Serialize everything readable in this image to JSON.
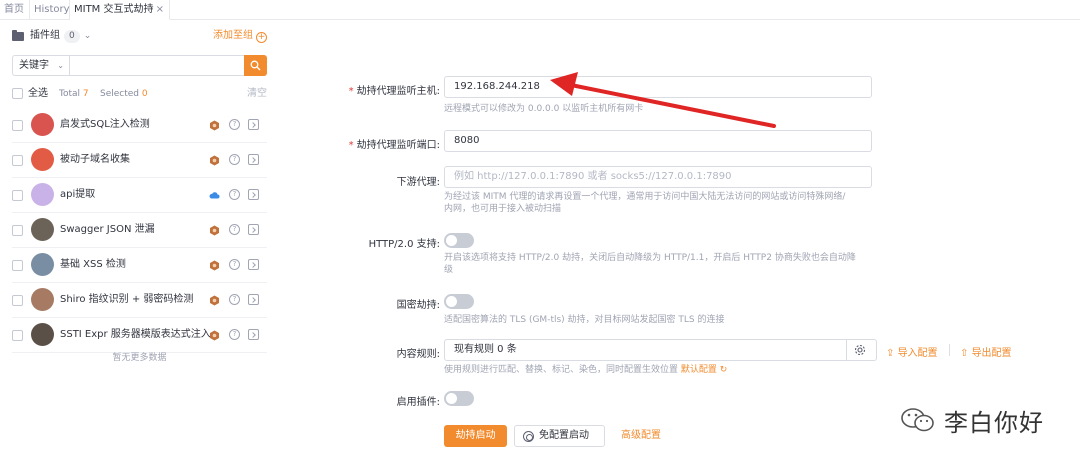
{
  "tabs": [
    {
      "label": "首页"
    },
    {
      "label": "History"
    },
    {
      "label": "MITM 交互式劫持",
      "close": "×"
    }
  ],
  "sidebar": {
    "group_label": "插件组",
    "group_count": "0",
    "add_group": "添加至组",
    "search": {
      "select_value": "关键字",
      "value": ""
    },
    "select_all": "全选",
    "total_label": "Total",
    "total_value": "7",
    "selected_label": "Selected",
    "selected_value": "0",
    "clear": "清空",
    "plugins": [
      {
        "name": "启发式SQL注入检测",
        "type_icon": "hexagon-badge-icon",
        "avatar_color": "#d9534f"
      },
      {
        "name": "被动子域名收集",
        "type_icon": "hexagon-badge-icon",
        "avatar_color": "#e25b45"
      },
      {
        "name": "api提取",
        "type_icon": "cloud-icon",
        "avatar_color": "#c9b2e8"
      },
      {
        "name": "Swagger JSON 泄漏",
        "type_icon": "hexagon-badge-icon",
        "avatar_color": "#6b6258"
      },
      {
        "name": "基础 XSS 检测",
        "type_icon": "hexagon-badge-icon",
        "avatar_color": "#7a8ea3"
      },
      {
        "name": "Shiro 指纹识别 + 弱密码检测",
        "type_icon": "hexagon-badge-icon",
        "avatar_color": "#a77b63"
      },
      {
        "name": "SSTI Expr 服务器模版表达式注入",
        "type_icon": "hexagon-badge-icon",
        "avatar_color": "#5a5048"
      }
    ],
    "no_more": "暂无更多数据"
  },
  "form": {
    "host_label": "劫持代理监听主机:",
    "host_value": "192.168.244.218",
    "host_hint": "远程模式可以修改为 0.0.0.0 以监听主机所有网卡",
    "port_label": "劫持代理监听端口:",
    "port_value": "8080",
    "downstream_label": "下游代理:",
    "downstream_placeholder": "例如 http://127.0.0.1:7890 或者 socks5://127.0.0.1:7890",
    "downstream_hint_1": "为经过该 MITM 代理的请求再设置一个代理，通常用于访问中国大陆无法访问的网站或访问特殊网络/",
    "downstream_hint_2": "内网，也可用于接入被动扫描",
    "http2_label": "HTTP/2.0 支持:",
    "http2_hint_1": "开启该选项将支持 HTTP/2.0 劫持，关闭后自动降级为 HTTP/1.1，开启后 HTTP2 协商失败也会自动降",
    "http2_hint_2": "级",
    "http2_enabled": false,
    "gm_label": "国密劫持:",
    "gm_hint": "适配国密算法的 TLS (GM-tls) 劫持，对目标网站发起国密 TLS 的连接",
    "gm_enabled": false,
    "rules_label": "内容规则:",
    "rules_value": "现有规则 0 条",
    "import_label": "导入配置",
    "export_label": "导出配置",
    "rules_hint": "使用规则进行匹配、替换、标记、染色，同时配置生效位置",
    "default_config": "默认配置",
    "plugin_label": "启用插件:",
    "plugin_enabled": false,
    "start_button": "劫持启动",
    "no_config_start": "免配置启动",
    "advanced_config": "高级配置"
  },
  "watermark": {
    "text": "李白你好"
  },
  "colors": {
    "accent": "#f28b2e",
    "required": "#e03b3b",
    "arrow": "#e02525"
  }
}
